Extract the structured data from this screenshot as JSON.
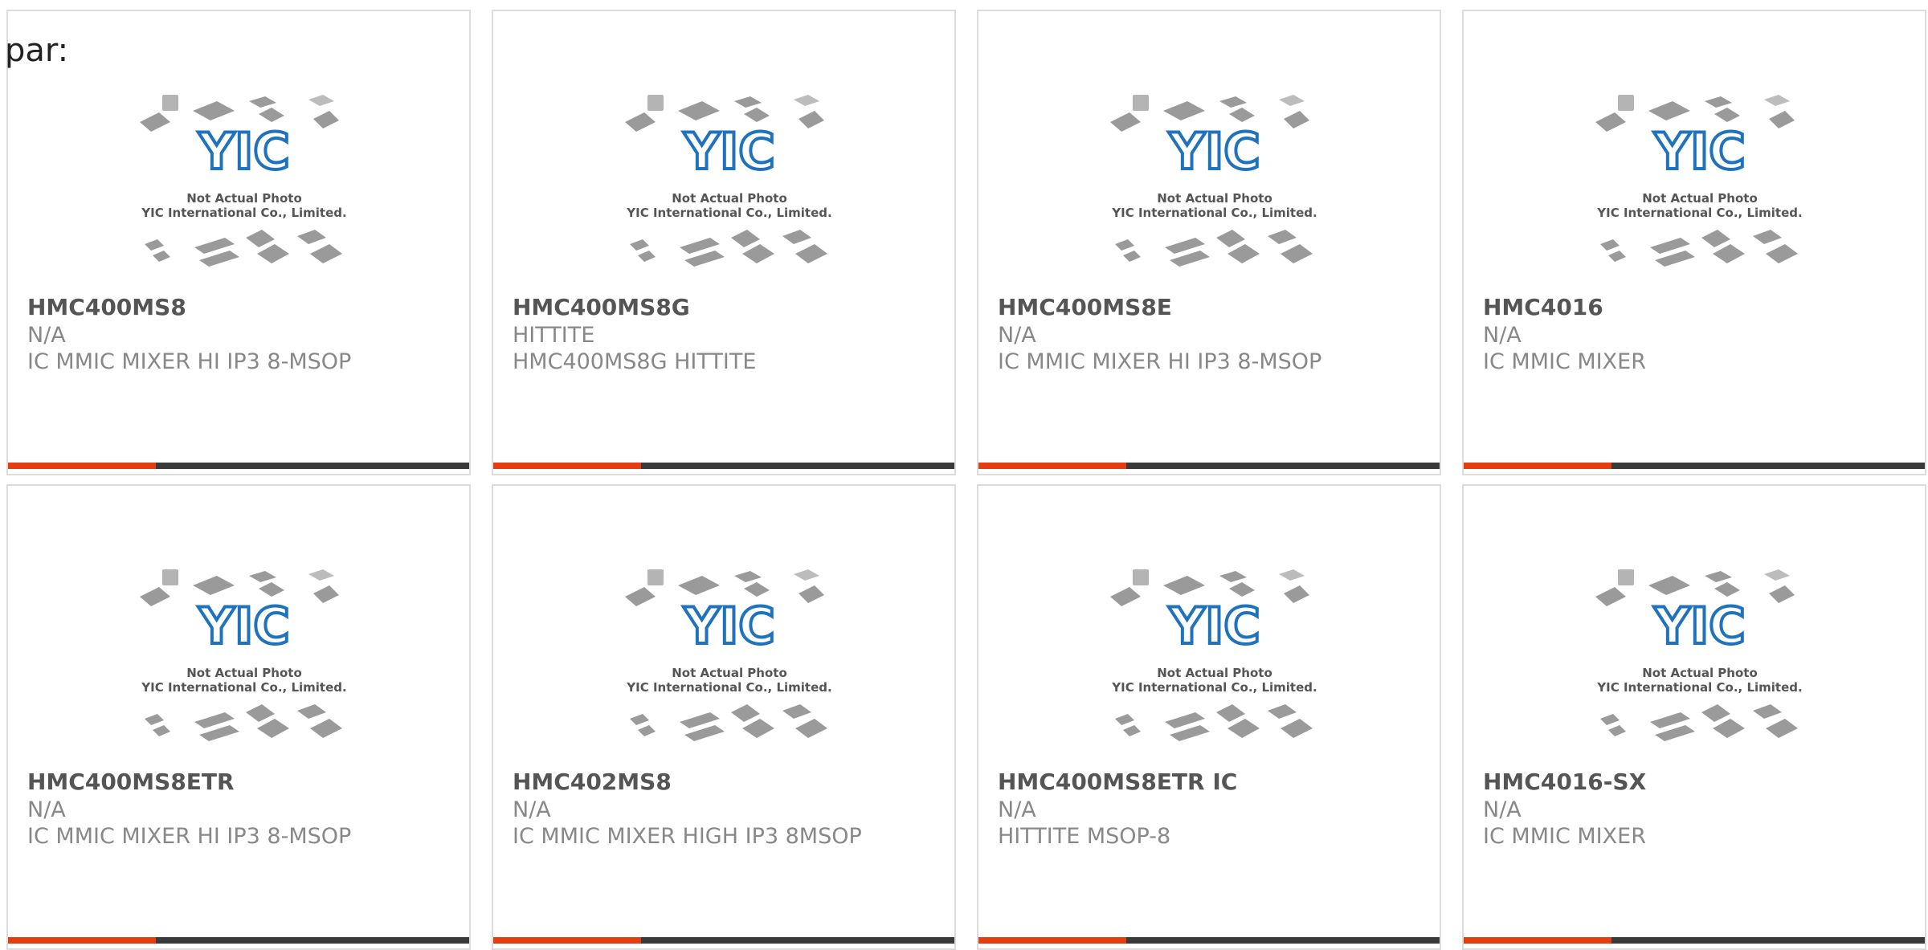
{
  "prefix_text": "par:",
  "colors": {
    "accent": "#e53d12",
    "bar": "#3a3a3a",
    "logo_blue": "#1f72bd"
  },
  "placeholder": {
    "logo_text": "YIC",
    "line1": "Not Actual Photo",
    "line2": "YIC International Co., Limited."
  },
  "products": [
    {
      "name": "HMC400MS8",
      "manufacturer": "N/A",
      "description": "IC MMIC MIXER HI IP3 8-MSOP"
    },
    {
      "name": "HMC400MS8G",
      "manufacturer": "HITTITE",
      "description": "HMC400MS8G HITTITE"
    },
    {
      "name": "HMC400MS8E",
      "manufacturer": "N/A",
      "description": "IC MMIC MIXER HI IP3 8-MSOP"
    },
    {
      "name": "HMC4016",
      "manufacturer": "N/A",
      "description": "IC MMIC MIXER"
    },
    {
      "name": "HMC400MS8ETR",
      "manufacturer": "N/A",
      "description": "IC MMIC MIXER HI IP3 8-MSOP"
    },
    {
      "name": "HMC402MS8",
      "manufacturer": "N/A",
      "description": "IC MMIC MIXER HIGH IP3 8MSOP"
    },
    {
      "name": "HMC400MS8ETR IC",
      "manufacturer": "N/A",
      "description": "HITTITE MSOP-8"
    },
    {
      "name": "HMC4016-SX",
      "manufacturer": "N/A",
      "description": "IC MMIC MIXER"
    }
  ]
}
